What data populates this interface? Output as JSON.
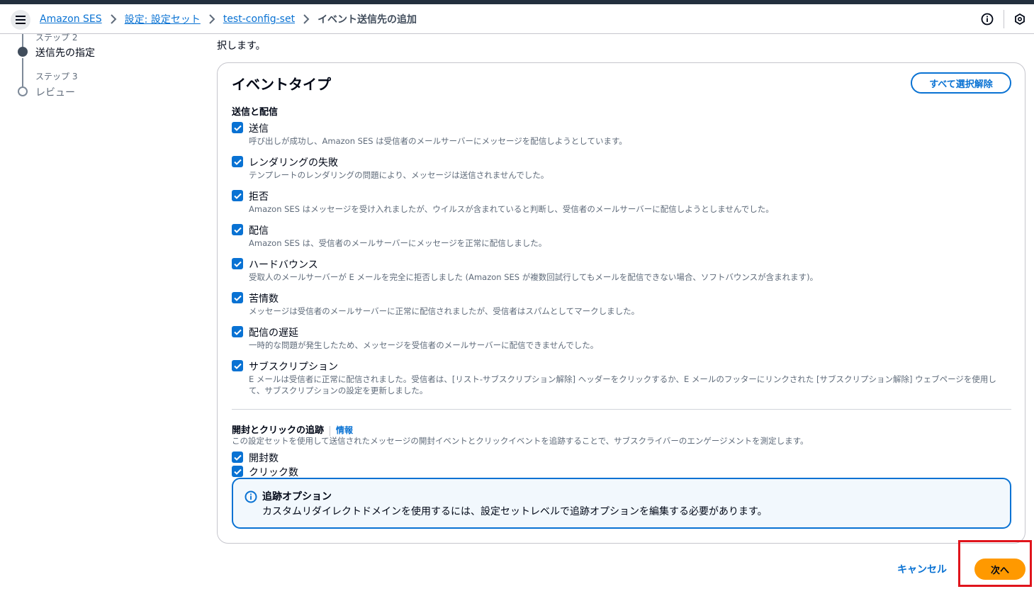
{
  "breadcrumb": {
    "items": [
      "Amazon SES",
      "設定: 設定セット",
      "test-config-set"
    ],
    "current": "イベント送信先の追加"
  },
  "header": {
    "info_icon": "info-circle-icon",
    "settings_icon": "hex-settings-icon"
  },
  "steps": {
    "step2_label": "ステップ 2",
    "step2_title": "送信先の指定",
    "step3_label": "ステップ 3",
    "step3_title": "レビュー"
  },
  "intro_text": "択します。",
  "card": {
    "title": "イベントタイプ",
    "deselect_all": "すべて選択解除",
    "section1_label": "送信と配信",
    "events": [
      {
        "label": "送信",
        "desc": "呼び出しが成功し、Amazon SES は受信者のメールサーバーにメッセージを配信しようとしています。",
        "checked": true
      },
      {
        "label": "レンダリングの失敗",
        "desc": "テンプレートのレンダリングの問題により、メッセージは送信されませんでした。",
        "checked": true
      },
      {
        "label": "拒否",
        "desc": "Amazon SES はメッセージを受け入れましたが、ウイルスが含まれていると判断し、受信者のメールサーバーに配信しようとしませんでした。",
        "checked": true
      },
      {
        "label": "配信",
        "desc": "Amazon SES は、受信者のメールサーバーにメッセージを正常に配信しました。",
        "checked": true
      },
      {
        "label": "ハードバウンス",
        "desc": "受取人のメールサーバーが E メールを完全に拒否しました (Amazon SES が複数回試行してもメールを配信できない場合、ソフトバウンスが含まれます)。",
        "checked": true
      },
      {
        "label": "苦情数",
        "desc": "メッセージは受信者のメールサーバーに正常に配信されましたが、受信者はスパムとしてマークしました。",
        "checked": true
      },
      {
        "label": "配信の遅延",
        "desc": "一時的な問題が発生したため、メッセージを受信者のメールサーバーに配信できませんでした。",
        "checked": true
      },
      {
        "label": "サブスクリプション",
        "desc": "E メールは受信者に正常に配信されました。受信者は、[リスト-サブスクリプション解除] ヘッダーをクリックするか、E メールのフッターにリンクされた [サブスクリプション解除] ウェブページを使用して、サブスクリプションの設定を更新しました。",
        "checked": true
      }
    ],
    "section2_label": "開封とクリックの追跡",
    "section2_info": "情報",
    "section2_desc": "この設定セットを使用して送信されたメッセージの開封イベントとクリックイベントを追跡することで、サブスクライバーのエンゲージメントを測定します。",
    "tracking": [
      {
        "label": "開封数",
        "checked": true
      },
      {
        "label": "クリック数",
        "checked": true
      }
    ],
    "alert_title": "追跡オプション",
    "alert_body": "カスタムリダイレクトドメインを使用するには、設定セットレベルで追跡オプションを編集する必要があります。"
  },
  "footer": {
    "cancel": "キャンセル",
    "next": "次へ"
  }
}
